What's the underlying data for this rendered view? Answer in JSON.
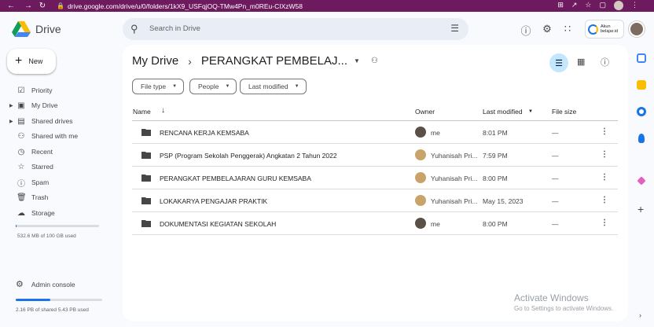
{
  "browser": {
    "url": "drive.google.com/drive/u/0/folders/1kX9_USFqjOQ-TMw4Pn_m0REu-CIXzW58"
  },
  "header": {
    "app_name": "Drive",
    "search_placeholder": "Search in Drive",
    "account_chip_text_line1": "Akun",
    "account_chip_text_line2": "belajar.id"
  },
  "sidebar": {
    "new_label": "New",
    "items": [
      {
        "label": "Priority",
        "icon": "priority-icon"
      },
      {
        "label": "My Drive",
        "icon": "my-drive-icon"
      },
      {
        "label": "Shared drives",
        "icon": "shared-drives-icon"
      },
      {
        "label": "Shared with me",
        "icon": "shared-with-me-icon"
      },
      {
        "label": "Recent",
        "icon": "recent-icon"
      },
      {
        "label": "Starred",
        "icon": "star-icon"
      },
      {
        "label": "Spam",
        "icon": "spam-icon"
      },
      {
        "label": "Trash",
        "icon": "trash-icon"
      },
      {
        "label": "Storage",
        "icon": "cloud-icon"
      }
    ],
    "storage_text": "532.6 MB of 100 GB used",
    "storage_fraction": 0.005,
    "admin_label": "Admin console",
    "shared_text": "2.16 PB of shared 5.43 PB used",
    "shared_fraction": 0.4
  },
  "main": {
    "breadcrumb_root": "My Drive",
    "breadcrumb_current": "PERANGKAT PEMBELAJ...",
    "filters": {
      "file_type": "File type",
      "people": "People",
      "last_modified": "Last modified"
    },
    "columns": {
      "name": "Name",
      "owner": "Owner",
      "last_modified": "Last modified",
      "file_size": "File size"
    },
    "rows": [
      {
        "name": "RENCANA KERJA KEMSABA",
        "owner": "me",
        "modified": "8:01 PM",
        "size": "—"
      },
      {
        "name": "PSP (Program Sekolah Penggerak) Angkatan 2 Tahun 2022",
        "owner": "Yuhanisah Pri...",
        "modified": "7:59 PM",
        "size": "—"
      },
      {
        "name": "PERANGKAT  PEMBELAJARAN GURU KEMSABA",
        "owner": "Yuhanisah Pri...",
        "modified": "8:00 PM",
        "size": "—"
      },
      {
        "name": "LOKAKARYA PENGAJAR PRAKTIK",
        "owner": "Yuhanisah Pri...",
        "modified": "May 15, 2023",
        "size": "—"
      },
      {
        "name": "DOKUMENTASI KEGIATAN SEKOLAH",
        "owner": "me",
        "modified": "8:00 PM",
        "size": "—"
      }
    ]
  },
  "watermark": {
    "line1": "Activate Windows",
    "line2": "Go to Settings to activate Windows."
  },
  "colors": {
    "accent": "#1a73e8",
    "browser_bar": "#6e1a5e",
    "selected_view": "#c2e7ff"
  }
}
